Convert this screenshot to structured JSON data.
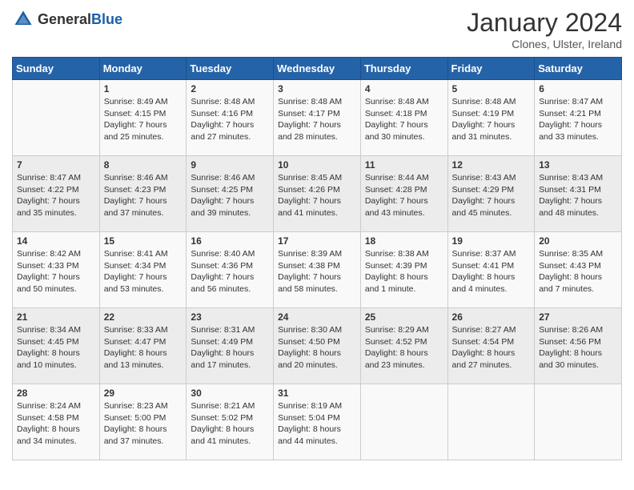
{
  "header": {
    "logo_general": "General",
    "logo_blue": "Blue",
    "title": "January 2024",
    "subtitle": "Clones, Ulster, Ireland"
  },
  "days_of_week": [
    "Sunday",
    "Monday",
    "Tuesday",
    "Wednesday",
    "Thursday",
    "Friday",
    "Saturday"
  ],
  "weeks": [
    [
      {
        "day": "",
        "sunrise": "",
        "sunset": "",
        "daylight": ""
      },
      {
        "day": "1",
        "sunrise": "Sunrise: 8:49 AM",
        "sunset": "Sunset: 4:15 PM",
        "daylight": "Daylight: 7 hours and 25 minutes."
      },
      {
        "day": "2",
        "sunrise": "Sunrise: 8:48 AM",
        "sunset": "Sunset: 4:16 PM",
        "daylight": "Daylight: 7 hours and 27 minutes."
      },
      {
        "day": "3",
        "sunrise": "Sunrise: 8:48 AM",
        "sunset": "Sunset: 4:17 PM",
        "daylight": "Daylight: 7 hours and 28 minutes."
      },
      {
        "day": "4",
        "sunrise": "Sunrise: 8:48 AM",
        "sunset": "Sunset: 4:18 PM",
        "daylight": "Daylight: 7 hours and 30 minutes."
      },
      {
        "day": "5",
        "sunrise": "Sunrise: 8:48 AM",
        "sunset": "Sunset: 4:19 PM",
        "daylight": "Daylight: 7 hours and 31 minutes."
      },
      {
        "day": "6",
        "sunrise": "Sunrise: 8:47 AM",
        "sunset": "Sunset: 4:21 PM",
        "daylight": "Daylight: 7 hours and 33 minutes."
      }
    ],
    [
      {
        "day": "7",
        "sunrise": "Sunrise: 8:47 AM",
        "sunset": "Sunset: 4:22 PM",
        "daylight": "Daylight: 7 hours and 35 minutes."
      },
      {
        "day": "8",
        "sunrise": "Sunrise: 8:46 AM",
        "sunset": "Sunset: 4:23 PM",
        "daylight": "Daylight: 7 hours and 37 minutes."
      },
      {
        "day": "9",
        "sunrise": "Sunrise: 8:46 AM",
        "sunset": "Sunset: 4:25 PM",
        "daylight": "Daylight: 7 hours and 39 minutes."
      },
      {
        "day": "10",
        "sunrise": "Sunrise: 8:45 AM",
        "sunset": "Sunset: 4:26 PM",
        "daylight": "Daylight: 7 hours and 41 minutes."
      },
      {
        "day": "11",
        "sunrise": "Sunrise: 8:44 AM",
        "sunset": "Sunset: 4:28 PM",
        "daylight": "Daylight: 7 hours and 43 minutes."
      },
      {
        "day": "12",
        "sunrise": "Sunrise: 8:43 AM",
        "sunset": "Sunset: 4:29 PM",
        "daylight": "Daylight: 7 hours and 45 minutes."
      },
      {
        "day": "13",
        "sunrise": "Sunrise: 8:43 AM",
        "sunset": "Sunset: 4:31 PM",
        "daylight": "Daylight: 7 hours and 48 minutes."
      }
    ],
    [
      {
        "day": "14",
        "sunrise": "Sunrise: 8:42 AM",
        "sunset": "Sunset: 4:33 PM",
        "daylight": "Daylight: 7 hours and 50 minutes."
      },
      {
        "day": "15",
        "sunrise": "Sunrise: 8:41 AM",
        "sunset": "Sunset: 4:34 PM",
        "daylight": "Daylight: 7 hours and 53 minutes."
      },
      {
        "day": "16",
        "sunrise": "Sunrise: 8:40 AM",
        "sunset": "Sunset: 4:36 PM",
        "daylight": "Daylight: 7 hours and 56 minutes."
      },
      {
        "day": "17",
        "sunrise": "Sunrise: 8:39 AM",
        "sunset": "Sunset: 4:38 PM",
        "daylight": "Daylight: 7 hours and 58 minutes."
      },
      {
        "day": "18",
        "sunrise": "Sunrise: 8:38 AM",
        "sunset": "Sunset: 4:39 PM",
        "daylight": "Daylight: 8 hours and 1 minute."
      },
      {
        "day": "19",
        "sunrise": "Sunrise: 8:37 AM",
        "sunset": "Sunset: 4:41 PM",
        "daylight": "Daylight: 8 hours and 4 minutes."
      },
      {
        "day": "20",
        "sunrise": "Sunrise: 8:35 AM",
        "sunset": "Sunset: 4:43 PM",
        "daylight": "Daylight: 8 hours and 7 minutes."
      }
    ],
    [
      {
        "day": "21",
        "sunrise": "Sunrise: 8:34 AM",
        "sunset": "Sunset: 4:45 PM",
        "daylight": "Daylight: 8 hours and 10 minutes."
      },
      {
        "day": "22",
        "sunrise": "Sunrise: 8:33 AM",
        "sunset": "Sunset: 4:47 PM",
        "daylight": "Daylight: 8 hours and 13 minutes."
      },
      {
        "day": "23",
        "sunrise": "Sunrise: 8:31 AM",
        "sunset": "Sunset: 4:49 PM",
        "daylight": "Daylight: 8 hours and 17 minutes."
      },
      {
        "day": "24",
        "sunrise": "Sunrise: 8:30 AM",
        "sunset": "Sunset: 4:50 PM",
        "daylight": "Daylight: 8 hours and 20 minutes."
      },
      {
        "day": "25",
        "sunrise": "Sunrise: 8:29 AM",
        "sunset": "Sunset: 4:52 PM",
        "daylight": "Daylight: 8 hours and 23 minutes."
      },
      {
        "day": "26",
        "sunrise": "Sunrise: 8:27 AM",
        "sunset": "Sunset: 4:54 PM",
        "daylight": "Daylight: 8 hours and 27 minutes."
      },
      {
        "day": "27",
        "sunrise": "Sunrise: 8:26 AM",
        "sunset": "Sunset: 4:56 PM",
        "daylight": "Daylight: 8 hours and 30 minutes."
      }
    ],
    [
      {
        "day": "28",
        "sunrise": "Sunrise: 8:24 AM",
        "sunset": "Sunset: 4:58 PM",
        "daylight": "Daylight: 8 hours and 34 minutes."
      },
      {
        "day": "29",
        "sunrise": "Sunrise: 8:23 AM",
        "sunset": "Sunset: 5:00 PM",
        "daylight": "Daylight: 8 hours and 37 minutes."
      },
      {
        "day": "30",
        "sunrise": "Sunrise: 8:21 AM",
        "sunset": "Sunset: 5:02 PM",
        "daylight": "Daylight: 8 hours and 41 minutes."
      },
      {
        "day": "31",
        "sunrise": "Sunrise: 8:19 AM",
        "sunset": "Sunset: 5:04 PM",
        "daylight": "Daylight: 8 hours and 44 minutes."
      },
      {
        "day": "",
        "sunrise": "",
        "sunset": "",
        "daylight": ""
      },
      {
        "day": "",
        "sunrise": "",
        "sunset": "",
        "daylight": ""
      },
      {
        "day": "",
        "sunrise": "",
        "sunset": "",
        "daylight": ""
      }
    ]
  ]
}
